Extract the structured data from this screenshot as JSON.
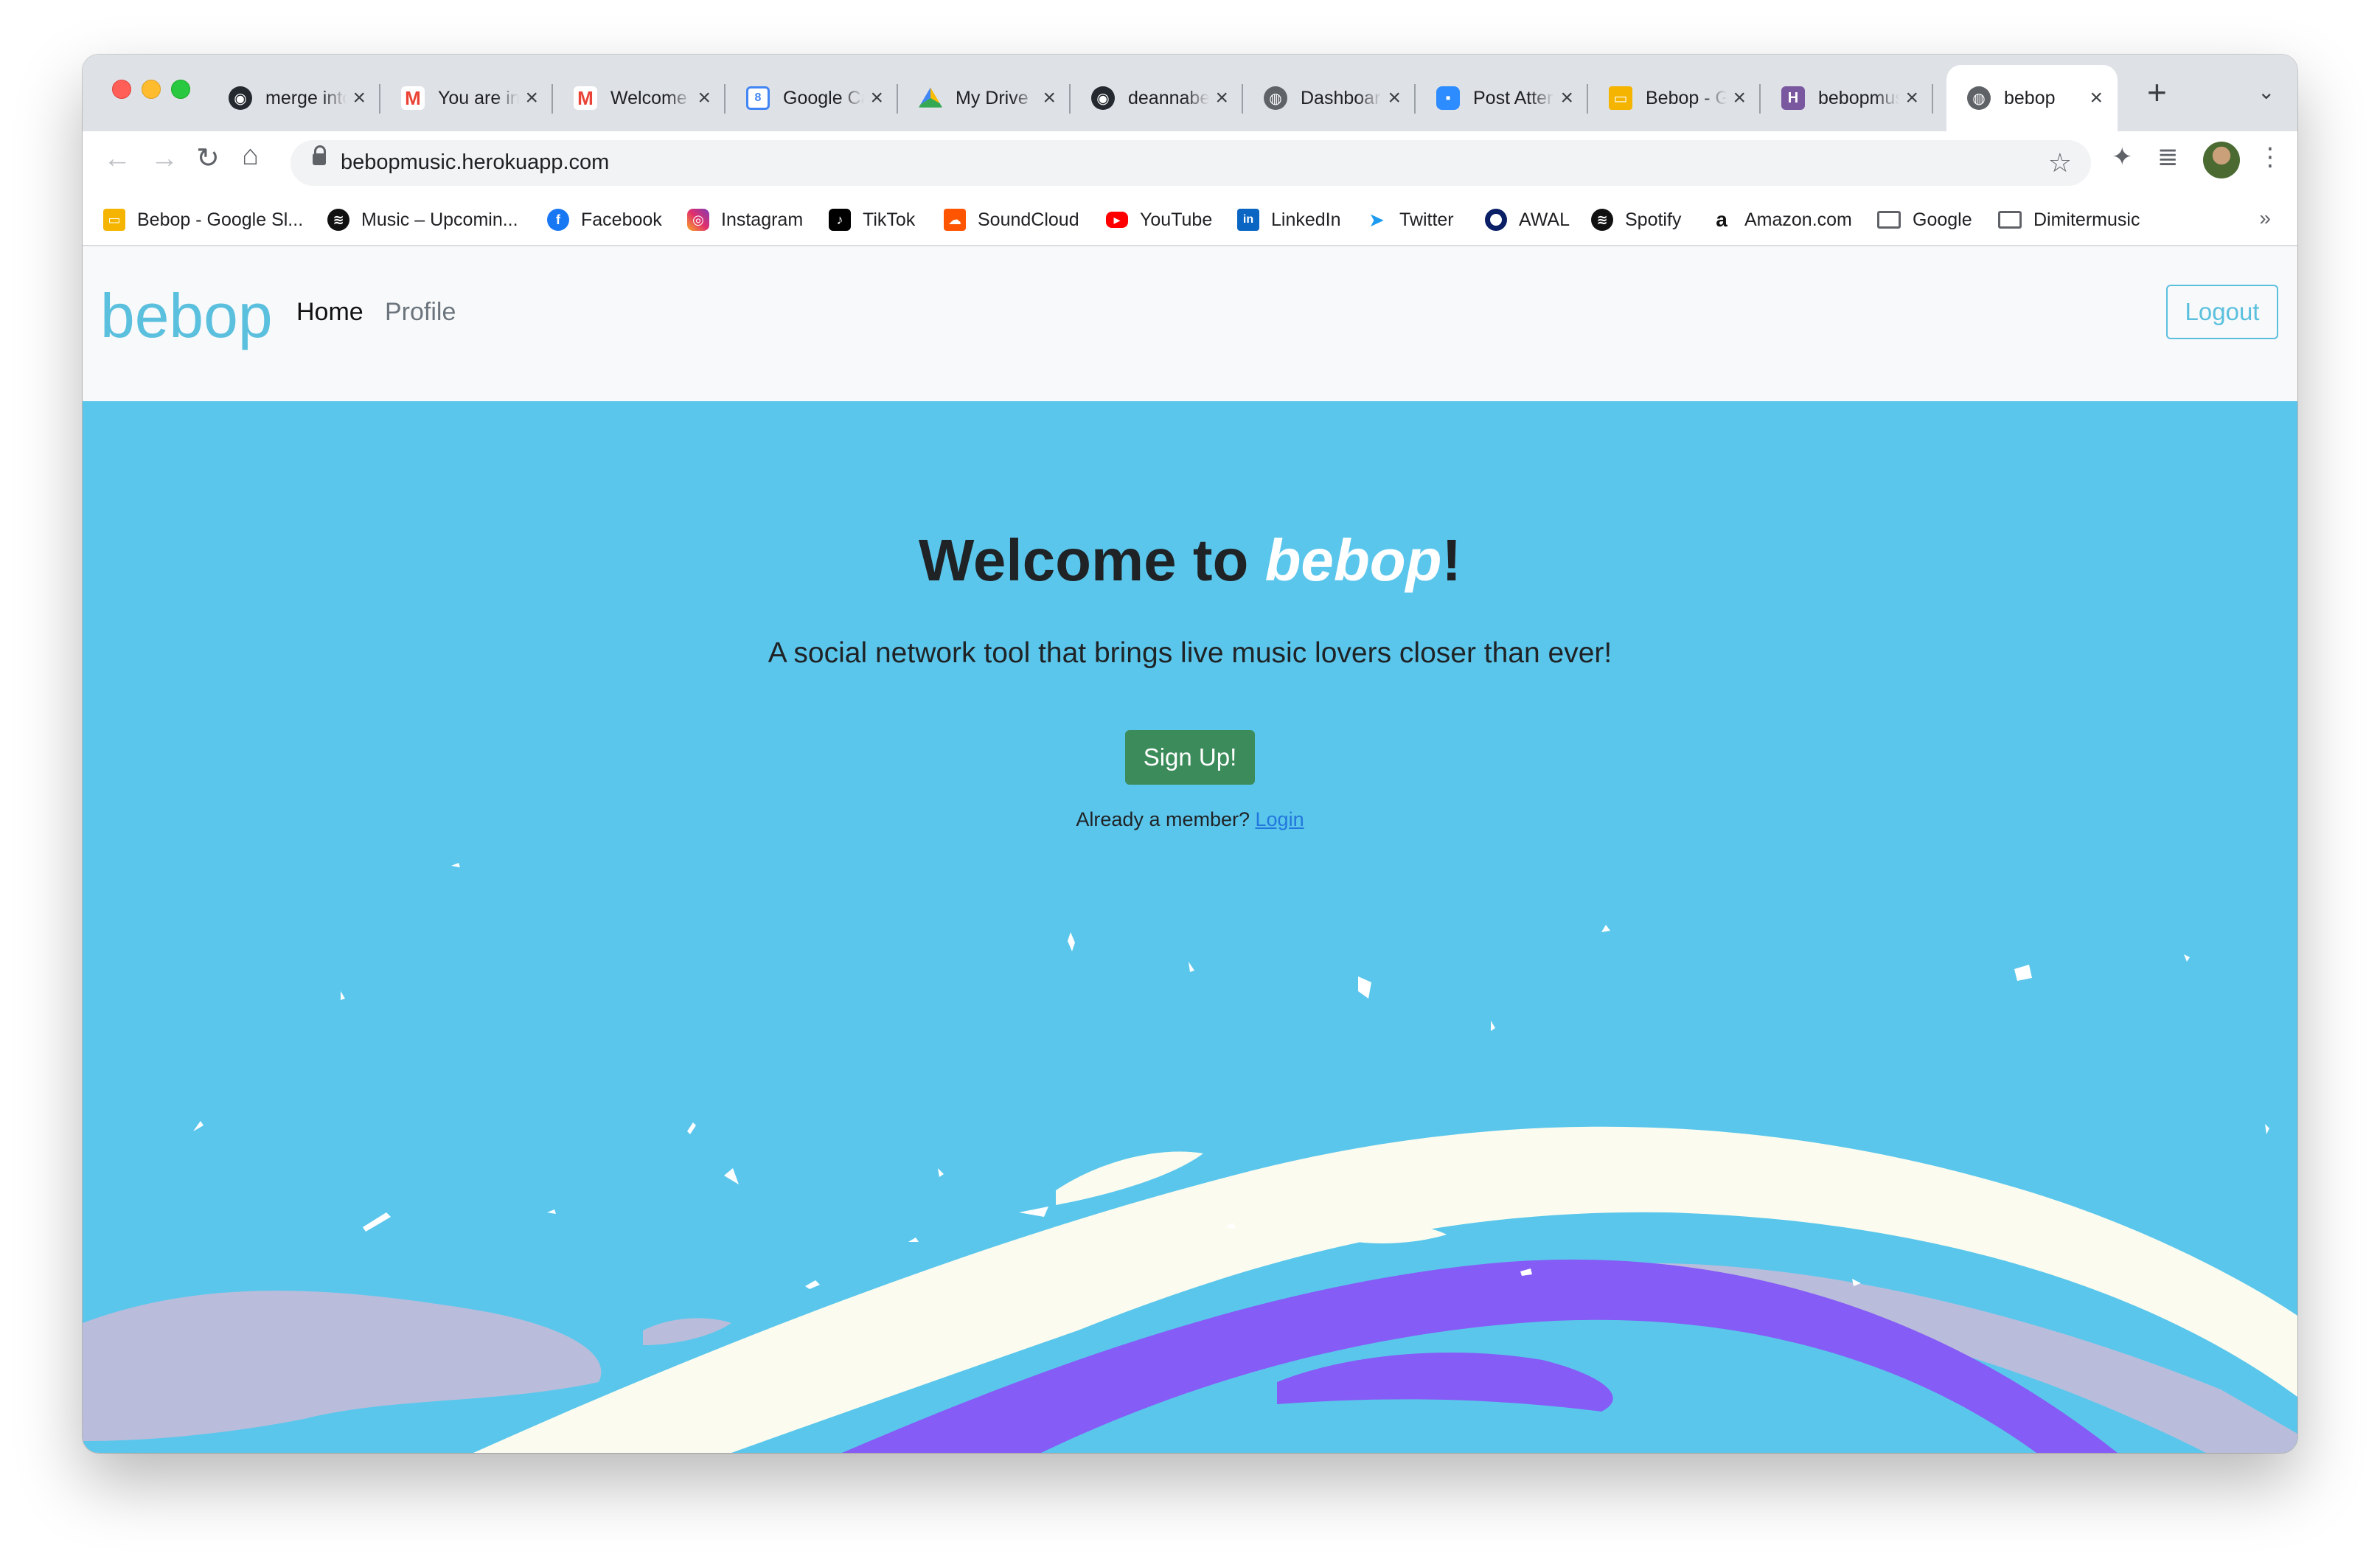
{
  "browser": {
    "tabs": [
      {
        "title": "merge into main",
        "favicon": "github-icon"
      },
      {
        "title": "You are invited",
        "favicon": "gmail-icon"
      },
      {
        "title": "Welcome to bebop",
        "favicon": "gmail-icon"
      },
      {
        "title": "Google Calendar",
        "favicon": "google-calendar-icon"
      },
      {
        "title": "My Drive",
        "favicon": "google-drive-icon"
      },
      {
        "title": "deannabebop",
        "favicon": "github-icon"
      },
      {
        "title": "Dashboard",
        "favicon": "globe-icon"
      },
      {
        "title": "Post Attendee",
        "favicon": "zoom-icon"
      },
      {
        "title": "Bebop - Google Slides",
        "favicon": "google-slides-icon"
      },
      {
        "title": "bebopmusic",
        "favicon": "heroku-icon"
      },
      {
        "title": "bebop",
        "favicon": "globe-icon",
        "active": true
      }
    ],
    "url": "bebopmusic.herokuapp.com",
    "bookmarks": [
      {
        "label": "Bebop - Google Sl...",
        "icon": "google-slides-icon"
      },
      {
        "label": "Music – Upcomin...",
        "icon": "spotify-icon"
      },
      {
        "label": "Facebook",
        "icon": "facebook-icon"
      },
      {
        "label": "Instagram",
        "icon": "instagram-icon"
      },
      {
        "label": "TikTok",
        "icon": "tiktok-icon"
      },
      {
        "label": "SoundCloud",
        "icon": "soundcloud-icon"
      },
      {
        "label": "YouTube",
        "icon": "youtube-icon"
      },
      {
        "label": "LinkedIn",
        "icon": "linkedin-icon"
      },
      {
        "label": "Twitter",
        "icon": "twitter-icon"
      },
      {
        "label": "AWAL",
        "icon": "awal-icon"
      },
      {
        "label": "Spotify",
        "icon": "spotify-icon"
      },
      {
        "label": "Amazon.com",
        "icon": "amazon-icon"
      },
      {
        "label": "Google",
        "icon": "folder-icon"
      },
      {
        "label": "Dimitermusic",
        "icon": "folder-icon"
      }
    ],
    "bookmarks_overflow": "»"
  },
  "site": {
    "brand": "bebop",
    "nav": {
      "home": "Home",
      "profile": "Profile"
    },
    "logout_label": "Logout",
    "hero": {
      "title_prefix": "Welcome to ",
      "title_brand": "bebop",
      "title_suffix": "!",
      "subtitle": "A social network tool that brings live music lovers closer than ever!",
      "signup_label": "Sign Up!",
      "member_text": "Already a member? ",
      "login_label": "Login"
    }
  },
  "colors": {
    "hero_bg": "#5bc6ec",
    "brand": "#5bc0de",
    "signup": "#3c8b5a",
    "swirl_purple": "#855cf5",
    "swirl_cream": "#fbfcef",
    "swirl_lavender": "#b9bddb"
  }
}
